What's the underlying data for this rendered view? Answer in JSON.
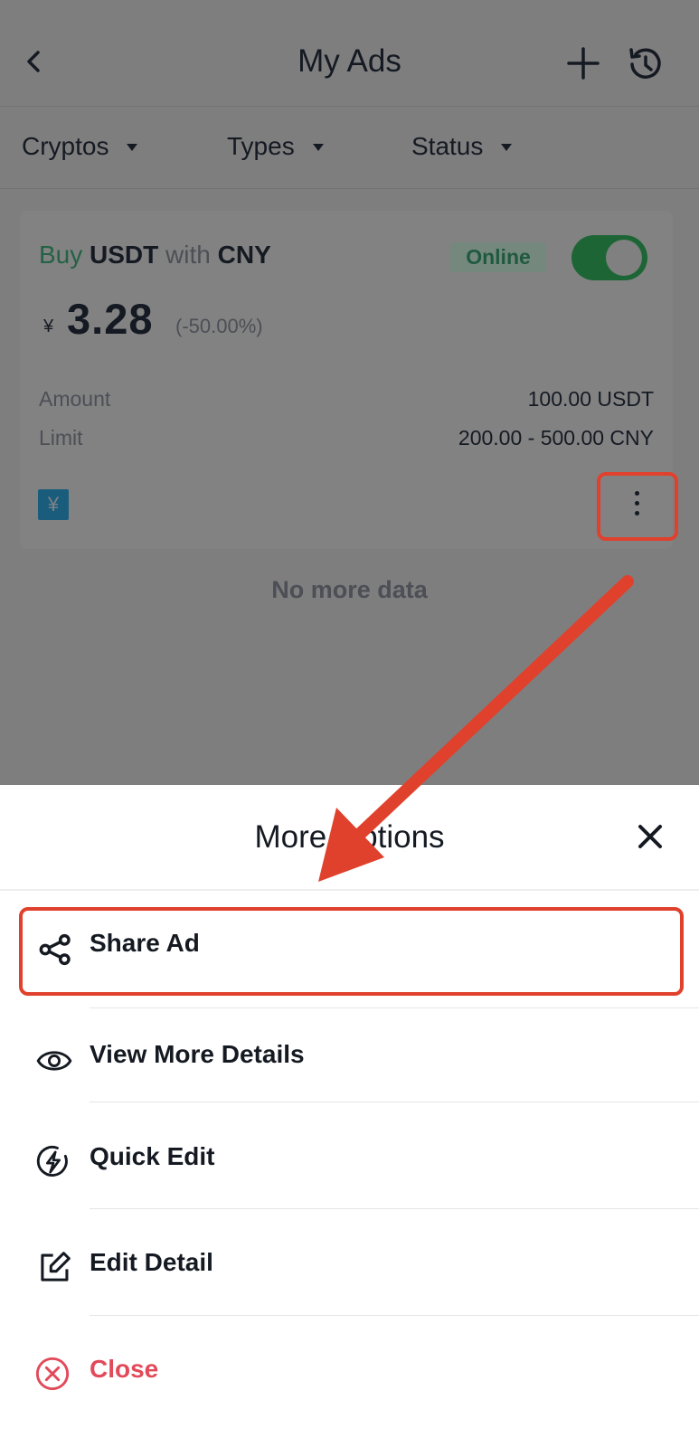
{
  "header": {
    "title": "My Ads",
    "back_icon": "chevron-left-icon",
    "add_icon": "plus-icon",
    "history_icon": "history-icon"
  },
  "filters": [
    {
      "label": "Cryptos"
    },
    {
      "label": "Types"
    },
    {
      "label": "Status"
    }
  ],
  "ad": {
    "side": "Buy",
    "asset": "USDT",
    "with_word": "with",
    "fiat": "CNY",
    "status": "Online",
    "online_toggle": true,
    "currency_symbol": "¥",
    "price": "3.28",
    "price_change": "(-50.00%)",
    "amount_label": "Amount",
    "amount_value": "100.00 USDT",
    "limit_label": "Limit",
    "limit_value": "200.00 - 500.00 CNY",
    "payment_icon_glyph": "¥",
    "more_icon": "more-vertical-icon"
  },
  "list_footer": "No more data",
  "sheet": {
    "title": "More Options",
    "close_icon": "close-icon",
    "options": [
      {
        "label": "Share Ad",
        "icon": "share-icon"
      },
      {
        "label": "View More Details",
        "icon": "eye-icon"
      },
      {
        "label": "Quick Edit",
        "icon": "lightning-icon"
      },
      {
        "label": "Edit Detail",
        "icon": "edit-icon"
      },
      {
        "label": "Close",
        "icon": "close-circle-icon"
      }
    ]
  },
  "colors": {
    "overlay_bg": "#7e7e7f",
    "buy_green": "#2ebd85",
    "danger_red": "#e24a5a",
    "annotation_red": "#e0412c"
  }
}
